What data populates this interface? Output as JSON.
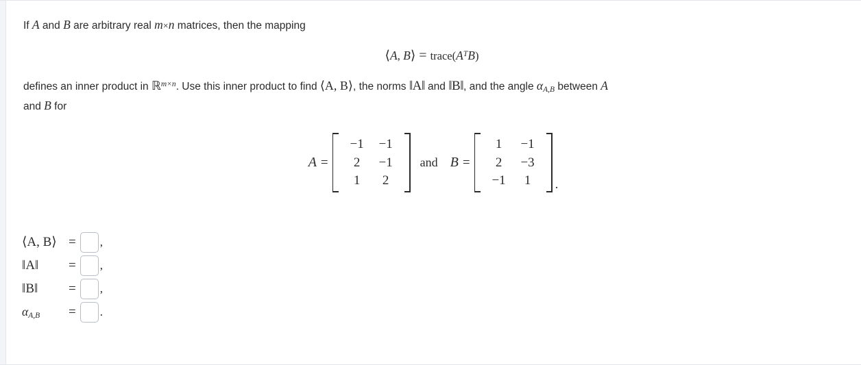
{
  "problem": {
    "intro_pre": "If ",
    "intro_A": "A",
    "intro_and": " and ",
    "intro_B": "B",
    "intro_mid": " are arbitrary real ",
    "intro_m": "m",
    "intro_times": "×",
    "intro_n": "n",
    "intro_post": " matrices, then the mapping",
    "display_lhs_open": "⟨",
    "display_A": "A",
    "display_comma": ", ",
    "display_B": "B",
    "display_lhs_close": "⟩",
    "display_equals": "=",
    "display_trace": "trace(",
    "display_At": "A",
    "display_T": "T",
    "display_B2": "B",
    "display_rparen": ")",
    "body_pre": "defines an inner product in ",
    "body_space": "ℝ",
    "body_space_sup": "m×n",
    "body_mid": ". Use this inner product to find ",
    "body_inner": "⟨A, B⟩",
    "body_mid2": ", the norms ",
    "body_normA": "‖A‖",
    "body_mid3": " and ",
    "body_normB": "‖B‖",
    "body_mid4": ", and the angle ",
    "body_alpha": "α",
    "body_alpha_sub": "A,B",
    "body_mid5": " between ",
    "body_A2": "A",
    "body_line2": "and ",
    "body_B2": "B",
    "body_line2_end": " for"
  },
  "matrices": {
    "A_label": "A",
    "equals": "=",
    "and": "and",
    "B_label": "B",
    "A_rows": [
      [
        "−1",
        "−1"
      ],
      [
        "2",
        "−1"
      ],
      [
        "1",
        "2"
      ]
    ],
    "B_rows": [
      [
        "1",
        "−1"
      ],
      [
        "2",
        "−3"
      ],
      [
        "−1",
        "1"
      ]
    ],
    "period": "."
  },
  "answers": {
    "rows": [
      {
        "label": "⟨A, B⟩",
        "equals": "=",
        "value": "",
        "placeholder": "",
        "trailing": ","
      },
      {
        "label": "‖A‖",
        "equals": "=",
        "value": "",
        "placeholder": "",
        "trailing": ","
      },
      {
        "label": "‖B‖",
        "equals": "=",
        "value": "",
        "placeholder": "",
        "trailing": ","
      },
      {
        "label": "α",
        "label_sub": "A,B",
        "equals": "=",
        "value": "",
        "placeholder": "",
        "trailing": "."
      }
    ]
  },
  "colors": {
    "text": "#2b2b2b",
    "box_border": "#b9bec6",
    "rail": "#f2f4f7"
  }
}
